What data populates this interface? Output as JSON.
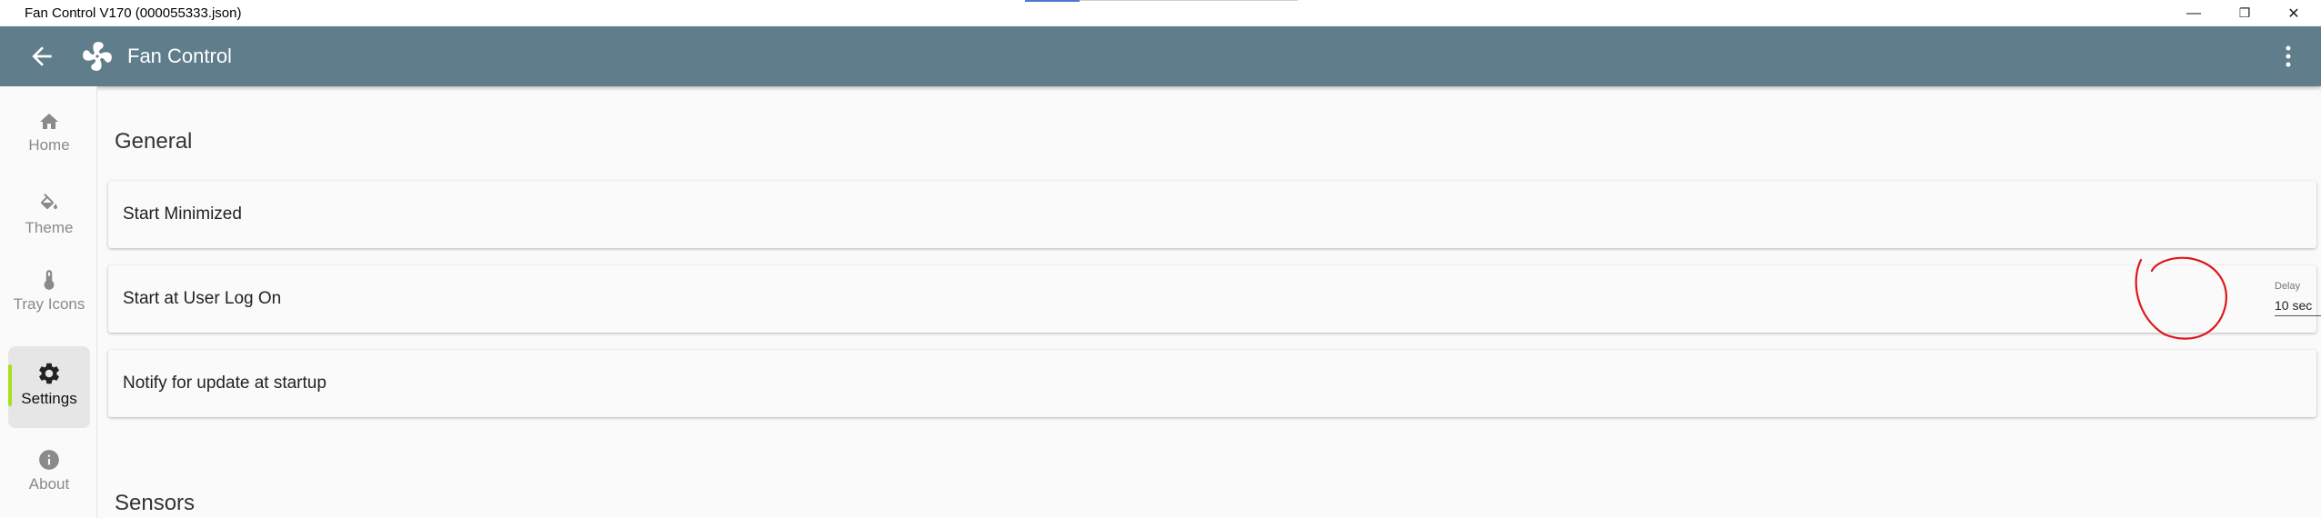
{
  "window": {
    "title": "Fan Control V170 (000055333.json)",
    "controls": {
      "minimize": "—",
      "restore": "❐",
      "close": "✕"
    }
  },
  "appbar": {
    "title": "Fan Control",
    "back_icon": "arrow-left-icon",
    "logo_icon": "fan-icon",
    "menu_icon": "more-vert-icon",
    "color": "#607d8b"
  },
  "sidebar": {
    "items": [
      {
        "label": "Home",
        "icon": "home-icon",
        "active": false
      },
      {
        "label": "Theme",
        "icon": "paint-bucket-icon",
        "active": false
      },
      {
        "label": "Tray Icons",
        "icon": "thermometer-icon",
        "active": false
      },
      {
        "label": "Settings",
        "icon": "gear-icon",
        "active": true
      },
      {
        "label": "About",
        "icon": "info-icon",
        "active": false
      }
    ],
    "accent_color": "#a6e21a"
  },
  "general": {
    "title": "General",
    "settings": [
      {
        "label": "Start Minimized",
        "enabled": true
      },
      {
        "label": "Start at User Log On",
        "enabled": true,
        "delay": {
          "label": "Delay",
          "value": "10 sec",
          "plus": "+",
          "minus": "-"
        }
      },
      {
        "label": "Notify for update at startup",
        "enabled": true
      }
    ]
  },
  "sensors": {
    "title": "Sensors"
  }
}
